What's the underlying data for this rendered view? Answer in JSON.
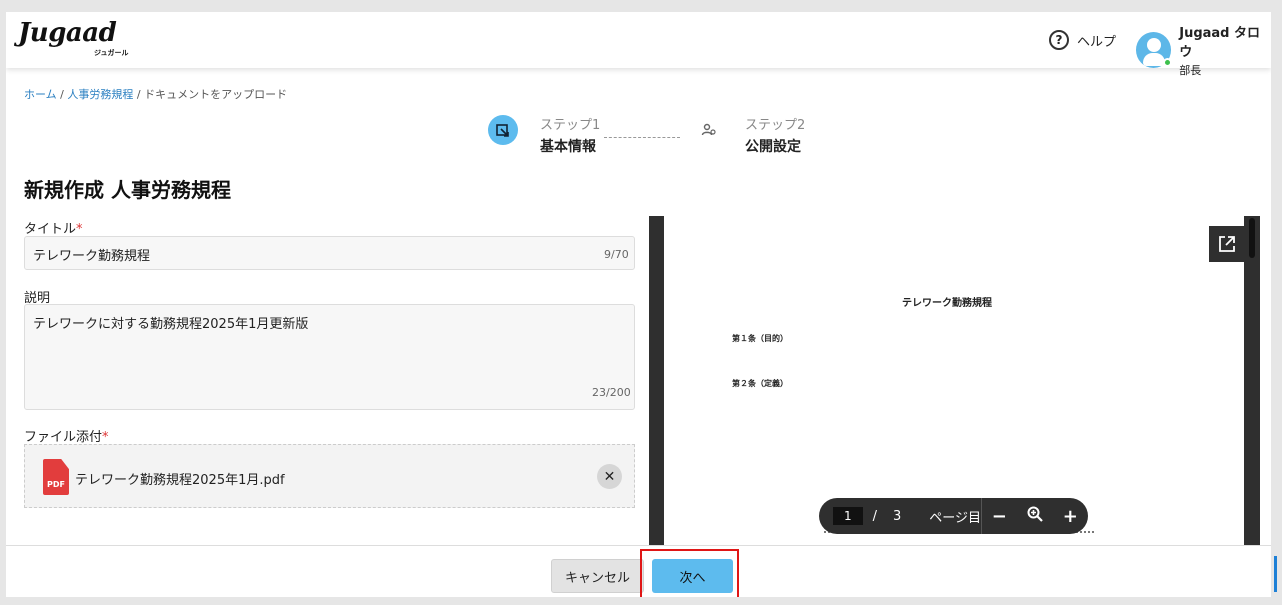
{
  "header": {
    "logo": "Jugaad",
    "logo_sub": "ジュガール",
    "help_label": "ヘルプ",
    "user_name": "Jugaad タロウ",
    "user_role": "部長"
  },
  "breadcrumb": {
    "home": "ホーム",
    "section": "人事労務規程",
    "current": "ドキュメントをアップロード",
    "sep": "/"
  },
  "steps": [
    {
      "step": "ステップ1",
      "label": "基本情報"
    },
    {
      "step": "ステップ2",
      "label": "公開設定"
    }
  ],
  "page_title": "新規作成 人事労務規程",
  "form": {
    "title_label": "タイトル",
    "title_value": "テレワーク勤務規程",
    "title_counter": "9/70",
    "desc_label": "説明",
    "desc_value": "テレワークに対する勤務規程2025年1月更新版",
    "desc_counter": "23/200",
    "file_label": "ファイル添付",
    "required_mark": "*",
    "file_name": "テレワーク勤務規程2025年1月.pdf",
    "file_icon_text": "PDF"
  },
  "viewer": {
    "doc_title": "テレワーク勤務規程",
    "lines": [
      "第１条（目的）",
      "第２条（定義）"
    ],
    "current_page": "1",
    "page_sep": "/",
    "total_pages": "3",
    "page_mode": "ページ目"
  },
  "footer": {
    "cancel_label": "キャンセル",
    "next_label": "次へ"
  },
  "colors": {
    "accent": "#5dbbee",
    "link": "#2a7fc1",
    "highlight": "#e01616",
    "pdf": "#e23d3d"
  }
}
